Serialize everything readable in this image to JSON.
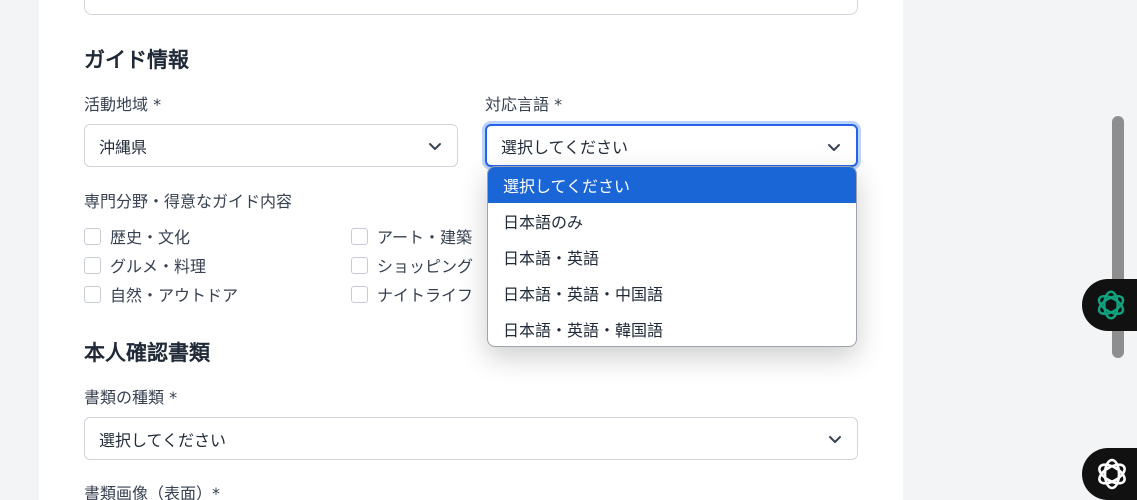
{
  "guide_section": {
    "title": "ガイド情報",
    "area_label": "活動地域 *",
    "area_value": "沖縄県",
    "language_label": "対応言語 *",
    "language_value": "選択してください",
    "specialty_label": "専門分野・得意なガイド内容",
    "specialties": [
      "歴史・文化",
      "アート・建築",
      "グルメ・料理",
      "ショッピング",
      "自然・アウトドア",
      "ナイトライフ"
    ]
  },
  "language_dropdown": {
    "options": [
      "選択してください",
      "日本語のみ",
      "日本語・英語",
      "日本語・英語・中国語",
      "日本語・英語・韓国語"
    ],
    "selected_index": 0
  },
  "id_section": {
    "title": "本人確認書類",
    "doc_type_label": "書類の種類 *",
    "doc_type_value": "選択してください",
    "image_front_label": "書類画像（表面）*"
  },
  "colors": {
    "accent": "#1a66d6",
    "focus_ring": "#2563eb"
  },
  "icons": [
    "chevron-down-icon",
    "openai-logo-icon"
  ]
}
